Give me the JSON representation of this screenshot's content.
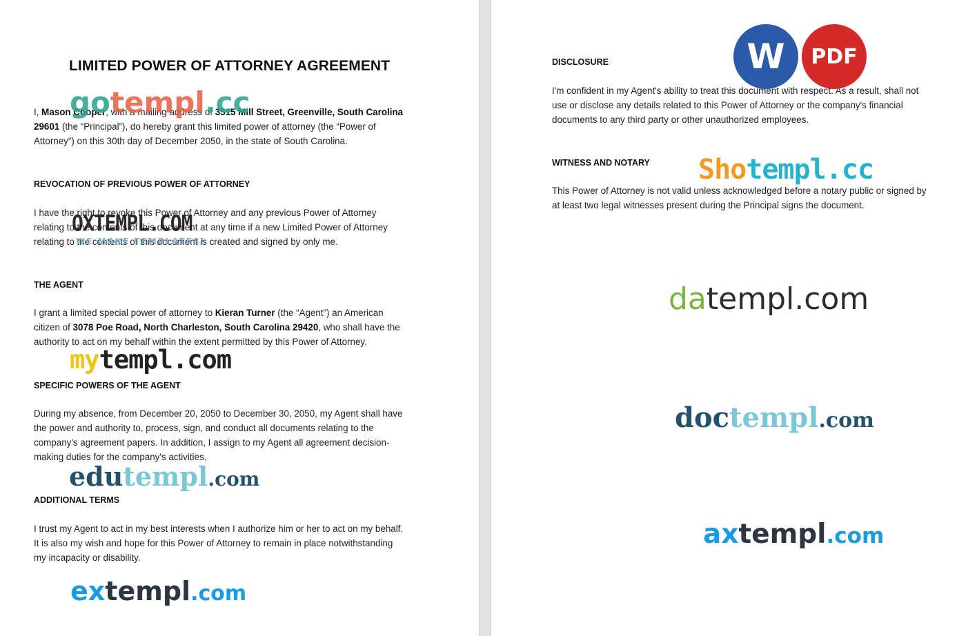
{
  "document": {
    "title": "LIMITED POWER OF ATTORNEY AGREEMENT",
    "intro": {
      "l1_a": "I, ",
      "l1_name": "Mason Cooper",
      "l1_b": ", with a mailing address of ",
      "l1_addr": "3515 Mill Street, Greenville, South Carolina",
      "l2_zip": "29601",
      "l2_b": " (the “Principal”), do hereby grant this limited power of attorney (the “Power of",
      "l3": "Attorney”) on this 30th day of December 2050, in the state of South Carolina."
    },
    "revocation": {
      "heading": "REVOCATION OF PREVIOUS POWER OF ATTORNEY",
      "lines": [
        "I have the right to revoke this Power of Attorney and any previous Power of Attorney",
        "relating to the contents of this document at any time if a new Limited Power of Attorney",
        "relating to the contents of this document is created and signed by only me."
      ]
    },
    "agent": {
      "heading": "THE AGENT",
      "l1_a": "I grant a limited special power of attorney to ",
      "l1_name": "Kieran Turner",
      "l1_b": " (the “Agent”) an American",
      "l2_a": "citizen of ",
      "l2_addr": "3078 Poe Road, North Charleston, South Carolina 29420",
      "l2_b": ", who shall have the",
      "l3": "authority to act on my behalf within the extent permitted by this Power of Attorney."
    },
    "specific_powers": {
      "heading": "SPECIFIC POWERS OF THE AGENT",
      "lines": [
        "During my absence, from December 20, 2050 to December 30, 2050, my Agent shall have",
        "the power and authority to, process, sign, and conduct all documents relating to the",
        "company's agreement papers. In addition, I assign to my Agent all agreement decision-",
        "making duties for the company's activities."
      ]
    },
    "additional_terms": {
      "heading": "ADDITIONAL TERMS",
      "lines": [
        "I trust my Agent to act in my best interests when I authorize him or her to act on my behalf.",
        "It is also my wish and hope for this Power of Attorney to remain in place notwithstanding",
        "my incapacity or disability."
      ]
    },
    "disclosure": {
      "heading": "DISCLOSURE",
      "lines": [
        "I'm confident in my Agent's ability to treat this document with respect. As a result, shall not",
        "use or disclose any details related to this Power of Attorney or the company's financial",
        "documents to any third party or other unauthorized employees."
      ]
    },
    "witness": {
      "heading": "WITNESS AND NOTARY",
      "lines": [
        "This Power of Attorney is not valid unless acknowledged before a notary public or signed by",
        "at least two legal witnesses present during the Principal signs the document."
      ]
    }
  },
  "badges": {
    "word": "W",
    "pdf": "PDF",
    "word_color": "#2b5aa8",
    "pdf_color": "#d42a2a"
  },
  "watermarks": {
    "gotempl": {
      "a": "go",
      "b": "templ",
      "c": ".cc"
    },
    "oxtempl": {
      "main": "OXTEMPL.COM",
      "sub": "WE MAKE TEMPLATES!"
    },
    "mytempl": {
      "a": "my",
      "b": "templ.com"
    },
    "edutempl": {
      "a": "edu",
      "b": "templ",
      "c": ".com"
    },
    "extempl": {
      "a": "ex",
      "b": "templ",
      "c": ".com"
    },
    "shotempl": {
      "a": "Sho",
      "b": "templ.cc"
    },
    "datempl": {
      "a": "da",
      "b": "templ.com"
    },
    "doctempl": {
      "a": "doc",
      "b": "templ",
      "c": ".com"
    },
    "axtempl": {
      "a": "ax",
      "b": "templ",
      "c": ".com"
    }
  }
}
